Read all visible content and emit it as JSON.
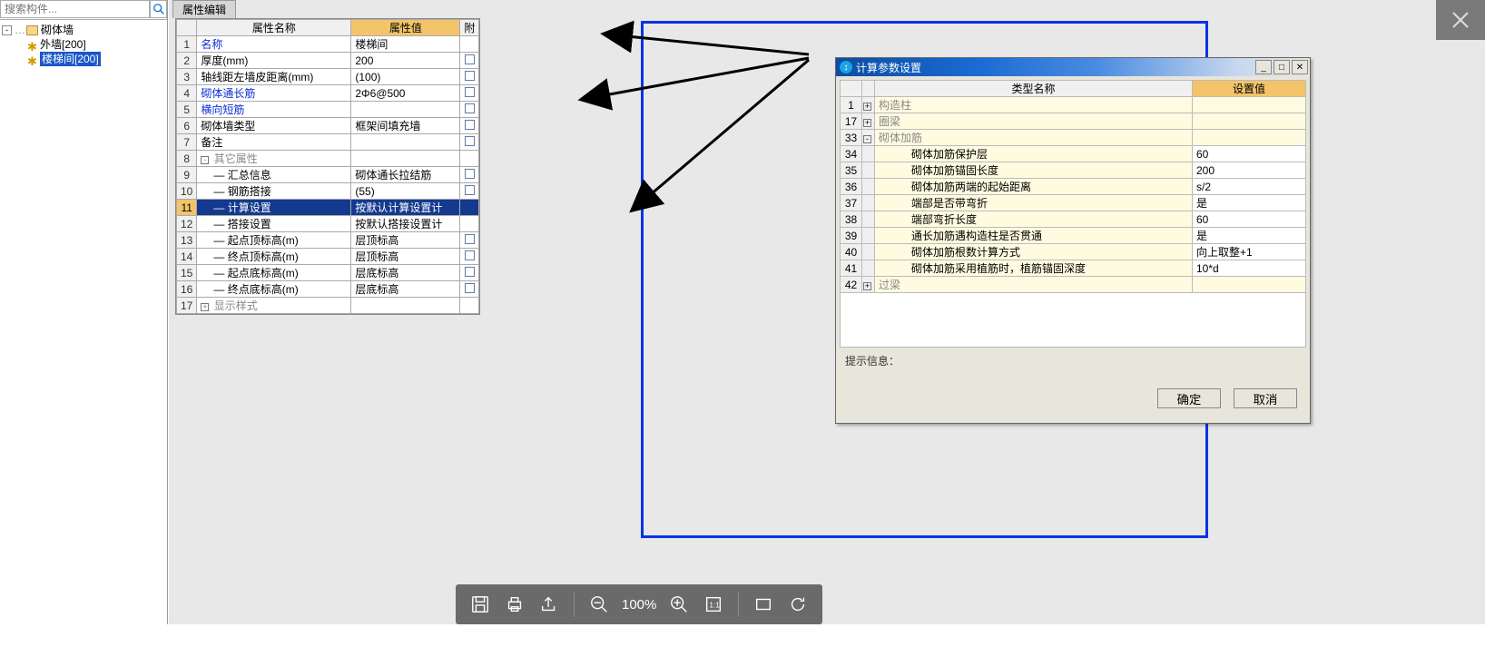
{
  "search": {
    "placeholder": "搜索构件..."
  },
  "tree": {
    "root": "砌体墙",
    "child1": "外墙[200]",
    "child2": "楼梯间[200]"
  },
  "tab": {
    "label": "属性编辑"
  },
  "prop_headers": {
    "name": "属性名称",
    "value": "属性值",
    "att": "附"
  },
  "props": [
    {
      "n": "1",
      "name": "名称",
      "val": "楼梯间",
      "att": "",
      "link": true
    },
    {
      "n": "2",
      "name": "厚度(mm)",
      "val": "200",
      "att": "chk"
    },
    {
      "n": "3",
      "name": "轴线距左墙皮距离(mm)",
      "val": "(100)",
      "att": "chk"
    },
    {
      "n": "4",
      "name": "砌体通长筋",
      "val": "2Φ6@500",
      "att": "chk",
      "link": true
    },
    {
      "n": "5",
      "name": "横向短筋",
      "val": "",
      "att": "chk",
      "link": true
    },
    {
      "n": "6",
      "name": "砌体墙类型",
      "val": "框架间填充墙",
      "att": "chk"
    },
    {
      "n": "7",
      "name": "备注",
      "val": "",
      "att": "chk"
    },
    {
      "n": "8",
      "name": "其它属性",
      "val": "",
      "att": "",
      "group": true,
      "toggle": "-"
    },
    {
      "n": "9",
      "name": "汇总信息",
      "val": "砌体通长拉结筋",
      "att": "chk",
      "child": true
    },
    {
      "n": "10",
      "name": "钢筋搭接",
      "val": "(55)",
      "att": "chk",
      "child": true
    },
    {
      "n": "11",
      "name": "计算设置",
      "val": "按默认计算设置计",
      "att": "",
      "child": true,
      "selected": true
    },
    {
      "n": "12",
      "name": "搭接设置",
      "val": "按默认搭接设置计",
      "att": "",
      "child": true
    },
    {
      "n": "13",
      "name": "起点顶标高(m)",
      "val": "层顶标高",
      "att": "chk",
      "child": true
    },
    {
      "n": "14",
      "name": "终点顶标高(m)",
      "val": "层顶标高",
      "att": "chk",
      "child": true
    },
    {
      "n": "15",
      "name": "起点底标高(m)",
      "val": "层底标高",
      "att": "chk",
      "child": true
    },
    {
      "n": "16",
      "name": "终点底标高(m)",
      "val": "层底标高",
      "att": "chk",
      "child": true
    },
    {
      "n": "17",
      "name": "显示样式",
      "val": "",
      "att": "",
      "group": true,
      "toggle": "+"
    }
  ],
  "dialog": {
    "title": "计算参数设置",
    "headers": {
      "name": "类型名称",
      "value": "设置值"
    },
    "rows": [
      {
        "n": "1",
        "t": "+",
        "name": "构造柱",
        "val": "",
        "group": true
      },
      {
        "n": "17",
        "t": "+",
        "name": "圈梁",
        "val": "",
        "group": true
      },
      {
        "n": "33",
        "t": "-",
        "name": "砌体加筋",
        "val": "",
        "group": true
      },
      {
        "n": "34",
        "t": "",
        "name": "砌体加筋保护层",
        "val": "60",
        "child": true
      },
      {
        "n": "35",
        "t": "",
        "name": "砌体加筋锚固长度",
        "val": "200",
        "child": true
      },
      {
        "n": "36",
        "t": "",
        "name": "砌体加筋两端的起始距离",
        "val": "s/2",
        "child": true
      },
      {
        "n": "37",
        "t": "",
        "name": "端部是否带弯折",
        "val": "是",
        "child": true
      },
      {
        "n": "38",
        "t": "",
        "name": "端部弯折长度",
        "val": "60",
        "child": true
      },
      {
        "n": "39",
        "t": "",
        "name": "通长加筋遇构造柱是否贯通",
        "val": "是",
        "child": true
      },
      {
        "n": "40",
        "t": "",
        "name": "砌体加筋根数计算方式",
        "val": "向上取整+1",
        "child": true
      },
      {
        "n": "41",
        "t": "",
        "name": "砌体加筋采用植筋时，植筋锚固深度",
        "val": "10*d",
        "child": true
      },
      {
        "n": "42",
        "t": "+",
        "name": "过梁",
        "val": "",
        "group": true
      }
    ],
    "hint": "提示信息：",
    "ok": "确定",
    "cancel": "取消"
  },
  "bottom": {
    "zoom": "100%"
  }
}
